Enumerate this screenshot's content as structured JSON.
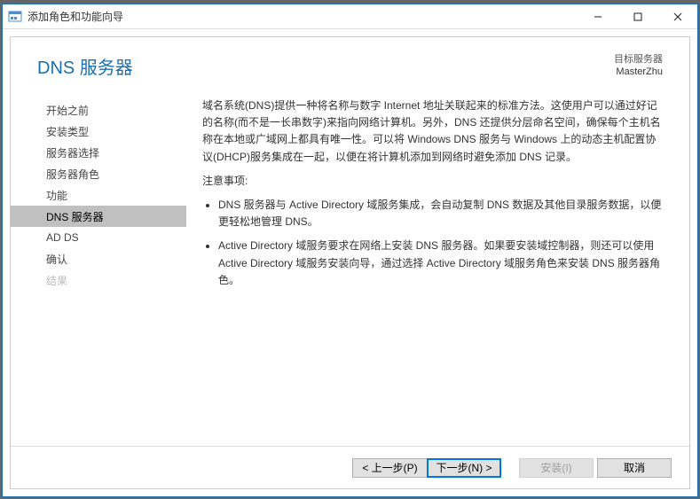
{
  "window": {
    "title": "添加角色和功能向导"
  },
  "header": {
    "page_title": "DNS 服务器",
    "target_label": "目标服务器",
    "target_value": "MasterZhu"
  },
  "sidebar": {
    "items": [
      {
        "label": "开始之前",
        "state": "done"
      },
      {
        "label": "安装类型",
        "state": "done"
      },
      {
        "label": "服务器选择",
        "state": "done"
      },
      {
        "label": "服务器角色",
        "state": "done"
      },
      {
        "label": "功能",
        "state": "done"
      },
      {
        "label": "DNS 服务器",
        "state": "selected"
      },
      {
        "label": "AD DS",
        "state": "done"
      },
      {
        "label": "确认",
        "state": "done"
      },
      {
        "label": "结果",
        "state": "disabled"
      }
    ]
  },
  "content": {
    "paragraph": "域名系统(DNS)提供一种将名称与数字 Internet 地址关联起来的标准方法。这使用户可以通过好记的名称(而不是一长串数字)来指向网络计算机。另外，DNS 还提供分层命名空间，确保每个主机名称在本地或广域网上都具有唯一性。可以将 Windows DNS 服务与 Windows 上的动态主机配置协议(DHCP)服务集成在一起，以便在将计算机添加到网络时避免添加 DNS 记录。",
    "notice_heading": "注意事项:",
    "bullets": [
      "DNS 服务器与 Active Directory 域服务集成，会自动复制 DNS 数据及其他目录服务数据，以便更轻松地管理 DNS。",
      "Active Directory 域服务要求在网络上安装 DNS 服务器。如果要安装域控制器，则还可以使用 Active Directory 域服务安装向导，通过选择 Active Directory 域服务角色来安装 DNS 服务器角色。"
    ]
  },
  "footer": {
    "prev": "< 上一步(P)",
    "next": "下一步(N) >",
    "install": "安装(I)",
    "cancel": "取消"
  }
}
